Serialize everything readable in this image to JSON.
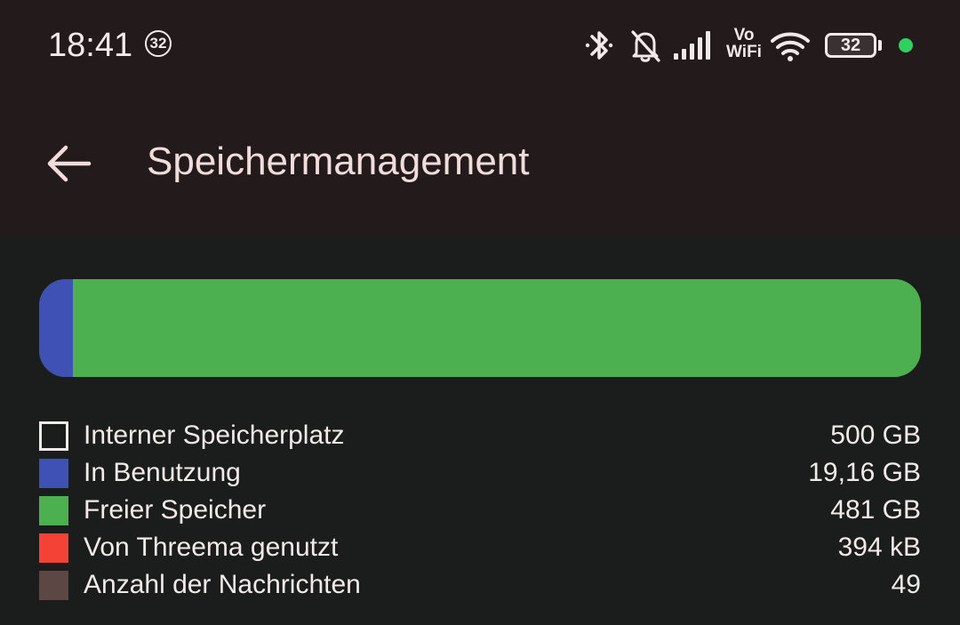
{
  "status_bar": {
    "time": "18:41",
    "notification_count": "32",
    "network_label_top": "Vo",
    "network_label_bottom": "WiFi",
    "battery_level": "32",
    "icons": [
      "bluetooth-icon",
      "bell-muted-icon",
      "signal-icon",
      "vowifi-icon",
      "wifi-icon",
      "battery-icon",
      "privacy-dot"
    ],
    "privacy_dot_color": "#2fd160"
  },
  "app_bar": {
    "back_icon": "arrow-left-icon",
    "title": "Speichermanagement"
  },
  "storage": {
    "total_gb": 500,
    "used_gb": 19.16,
    "free_gb": 481,
    "used_fraction": 0.0383
  },
  "legend": [
    {
      "label": "Interner Speicherplatz",
      "value": "500 GB",
      "color": "#f2eaea",
      "style": "outline"
    },
    {
      "label": "In Benutzung",
      "value": "19,16 GB",
      "color": "#3f51b5",
      "style": "fill"
    },
    {
      "label": "Freier Speicher",
      "value": "481 GB",
      "color": "#4caf50",
      "style": "fill"
    },
    {
      "label": "Von Threema genutzt",
      "value": "394 kB",
      "color": "#f44336",
      "style": "fill"
    },
    {
      "label": "Anzahl der Nachrichten",
      "value": "49",
      "color": "#5d4745",
      "style": "fill"
    }
  ],
  "colors": {
    "app_bar_bg": "#231b1b",
    "page_bg": "#1b1d1c",
    "title_text": "#f0dcda",
    "used": "#3f51b5",
    "free": "#4caf50"
  }
}
